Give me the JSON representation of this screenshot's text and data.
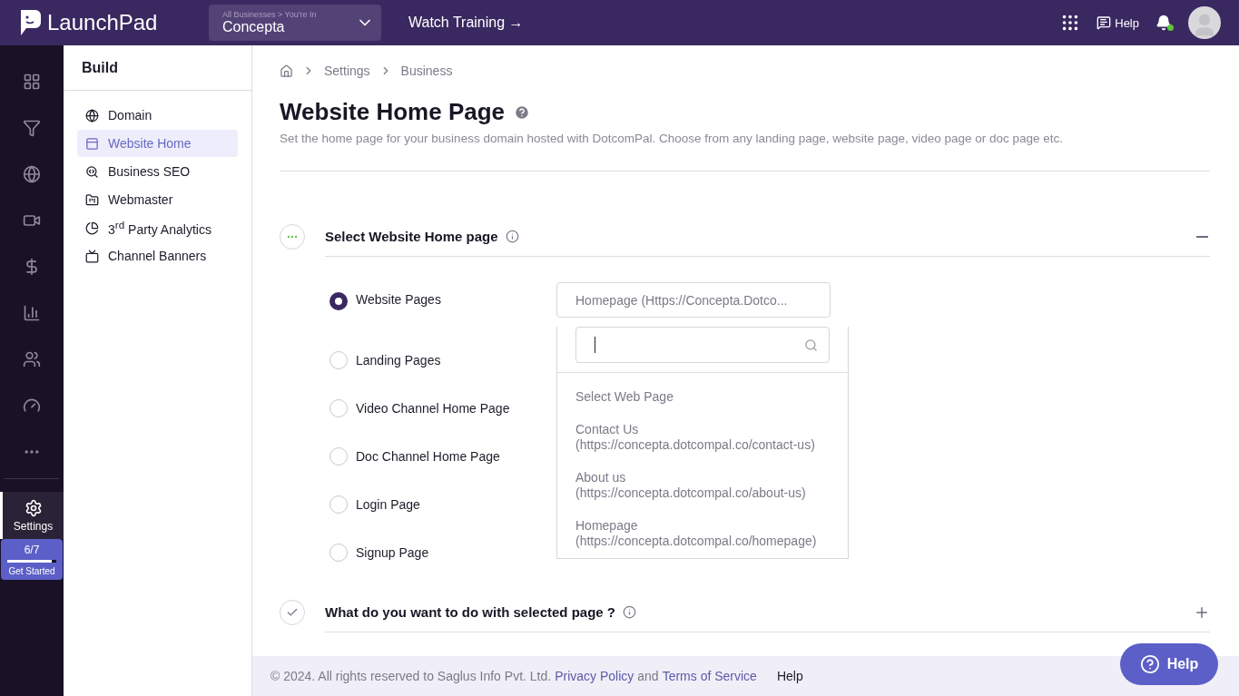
{
  "header": {
    "brand": "LaunchPad",
    "business_switcher": {
      "caption": "All Businesses > You're In",
      "value": "Concepta"
    },
    "watch_training": "Watch Training →",
    "help": "Help",
    "notification_dot": true
  },
  "rail": {
    "settings": {
      "label": "Settings",
      "selected": true
    },
    "progress": {
      "count": "6/7",
      "level": 0.9,
      "label": "Get Started"
    }
  },
  "sidebar": {
    "title": "Build",
    "items": [
      {
        "label": "Domain",
        "selected": false
      },
      {
        "label": "Website Home",
        "selected": true
      },
      {
        "label": "Business SEO",
        "selected": false
      },
      {
        "label": "Webmaster",
        "selected": false
      },
      {
        "label": "3$^{rd}$ Party Analytics",
        "selected": false
      },
      {
        "label": "Channel Banners",
        "selected": false
      }
    ]
  },
  "breadcrumb": [
    "Settings",
    "Business"
  ],
  "page": {
    "title": "Website Home Page",
    "description": "Set the home page for your business domain hosted with DotcomPal. Choose from any landing page, website page, video page or doc page etc."
  },
  "sections": [
    {
      "title": "Select Website Home page",
      "expanded": true,
      "done": false,
      "options": [
        {
          "label": "Website Pages",
          "selected": true
        },
        {
          "label": "Landing Pages",
          "selected": false
        },
        {
          "label": "Video Channel Home Page",
          "selected": false
        },
        {
          "label": "Doc Channel Home Page",
          "selected": false
        },
        {
          "label": "Login Page",
          "selected": false
        },
        {
          "label": "Signup Page",
          "selected": false
        }
      ],
      "dropdown": {
        "value": "Homepage (Https://Concepta.Dotco...",
        "open": true,
        "items": [
          {
            "label": "Select Web Page"
          },
          {
            "label": "Contact Us",
            "url": "(https://concepta.dotcompal.co/contact-us)"
          },
          {
            "label": "About us",
            "url": "(https://concepta.dotcompal.co/about-us)"
          },
          {
            "label": "Homepage",
            "url": "(https://concepta.dotcompal.co/homepage)"
          }
        ]
      }
    },
    {
      "title": "What do you want to do with selected page ?",
      "expanded": false,
      "done": true
    }
  ],
  "footer": {
    "copyright": "©  2024. All rights reserved to Saglus Info Pvt. Ltd.",
    "privacy": "Privacy Policy",
    "and": "and",
    "terms": "Terms of Service",
    "help": "Help"
  },
  "help_button": "Help"
}
